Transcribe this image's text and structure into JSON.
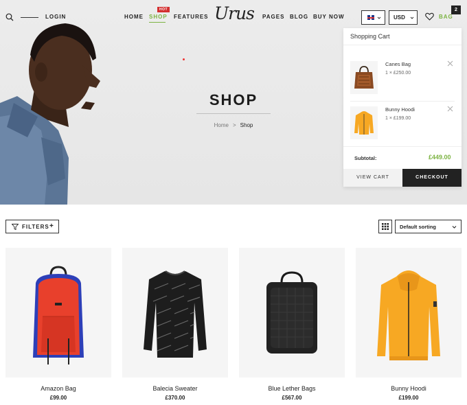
{
  "header": {
    "login": "LOGIN",
    "nav_left": [
      "HOME",
      "SHOP",
      "FEATURES"
    ],
    "hot_badge": "HOT",
    "logo": "Urus",
    "nav_right": [
      "PAGES",
      "BLOG",
      "BUY NOW"
    ],
    "currency": "USD",
    "bag_label": "BAG",
    "bag_count": "2"
  },
  "hero": {
    "title": "SHOP",
    "breadcrumb_home": "Home",
    "breadcrumb_sep": ">",
    "breadcrumb_current": "Shop"
  },
  "cart": {
    "title": "Shopping Cart",
    "items": [
      {
        "name": "Canes Bag",
        "qty_price": "1 × £250.00"
      },
      {
        "name": "Bunny Hoodi",
        "qty_price": "1 × £199.00"
      }
    ],
    "subtotal_label": "Subtotal:",
    "subtotal_value": "£449.00",
    "view_cart": "VIEW CART",
    "checkout": "CHECKOUT"
  },
  "toolbar": {
    "filters": "FILTERS",
    "filters_plus": "+",
    "sort": "Default sorting"
  },
  "products": [
    {
      "name": "Amazon Bag",
      "price": "£99.00"
    },
    {
      "name": "Balecia Sweater",
      "price": "£370.00"
    },
    {
      "name": "Blue Lether Bags",
      "price": "£567.00"
    },
    {
      "name": "Bunny Hoodi",
      "price": "£199.00"
    }
  ],
  "colors": {
    "accent": "#7cb342",
    "hot": "#d32f2f",
    "dark": "#222222"
  }
}
